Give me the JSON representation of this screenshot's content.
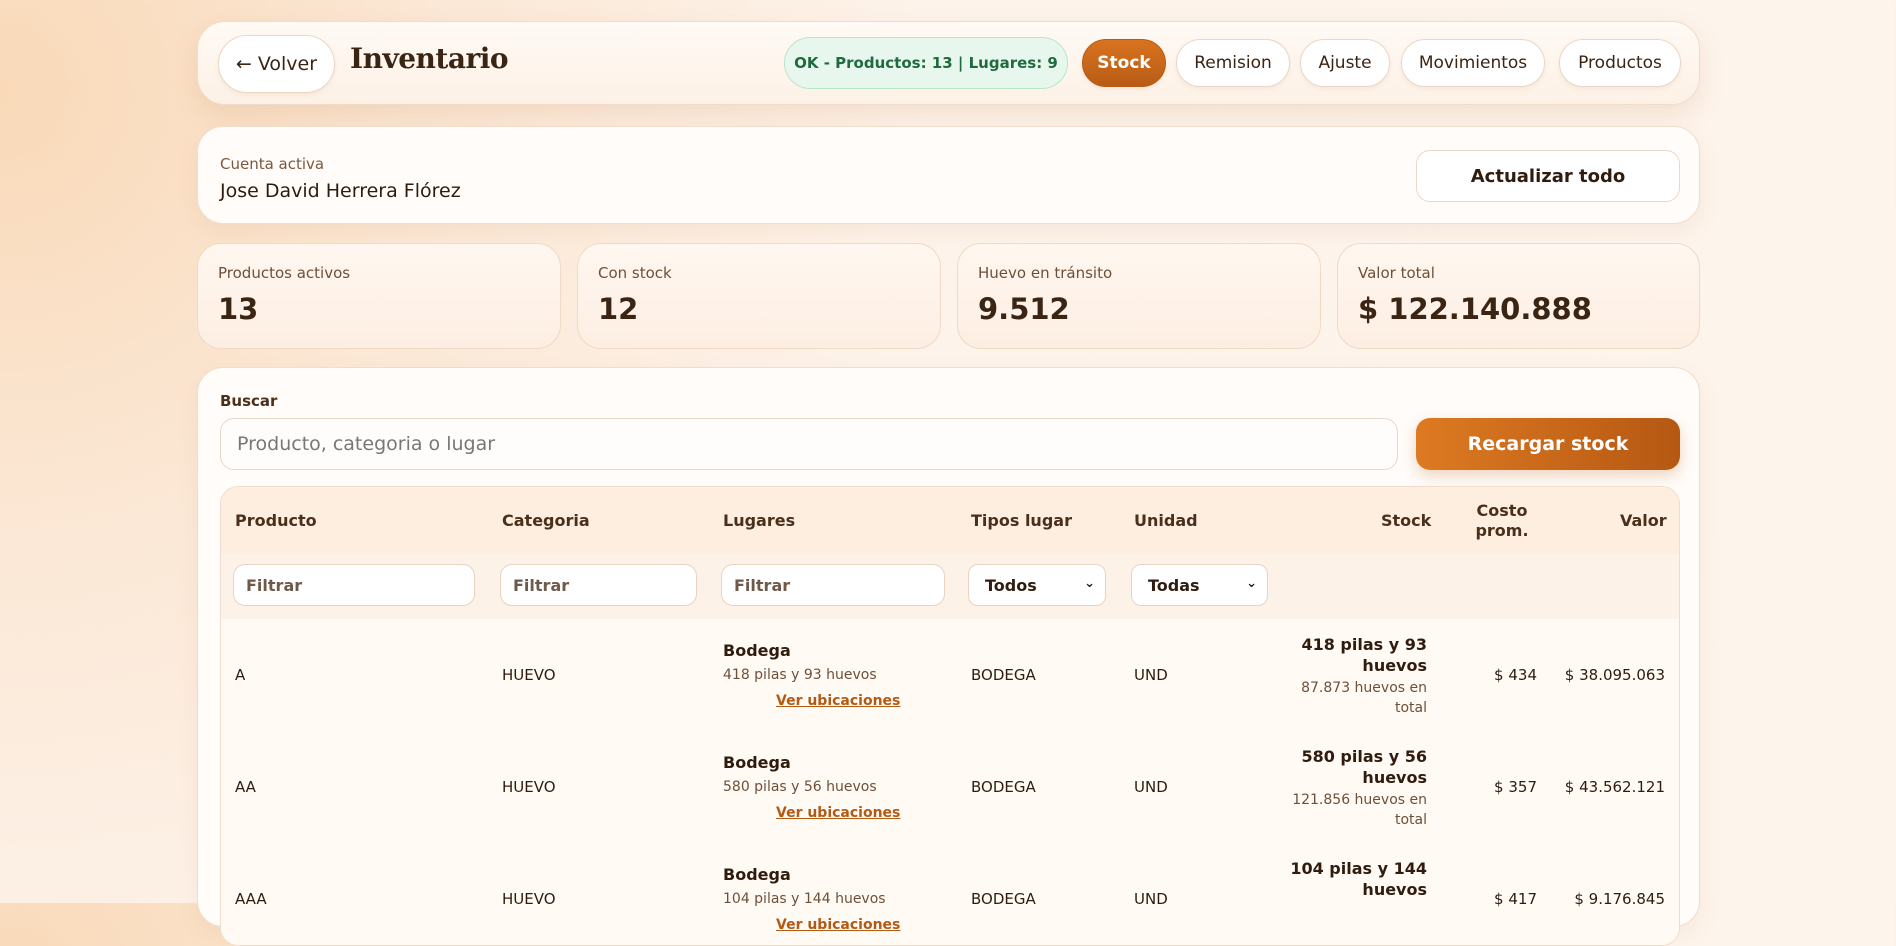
{
  "header": {
    "back_label": "← Volver",
    "title": "Inventario",
    "status": "OK - Productos: 13 | Lugares: 9",
    "tabs": [
      "Stock",
      "Remision",
      "Ajuste",
      "Movimientos",
      "Productos"
    ],
    "active_tab": "Stock"
  },
  "account": {
    "label": "Cuenta activa",
    "name": "Jose David Herrera Flórez",
    "refresh_label": "Actualizar todo"
  },
  "stats": [
    {
      "label": "Productos activos",
      "value": "13"
    },
    {
      "label": "Con stock",
      "value": "12"
    },
    {
      "label": "Huevo en tránsito",
      "value": "9.512"
    },
    {
      "label": "Valor total",
      "value": "$ 122.140.888"
    }
  ],
  "search": {
    "label": "Buscar",
    "placeholder": "Producto, categoria o lugar",
    "reload_label": "Recargar stock"
  },
  "table": {
    "headers": {
      "producto": "Producto",
      "categoria": "Categoria",
      "lugares": "Lugares",
      "tipos_lugar": "Tipos lugar",
      "unidad": "Unidad",
      "stock": "Stock",
      "costo": "Costo prom.",
      "valor": "Valor"
    },
    "filter_placeholder": "Filtrar",
    "tipos_lugar_filter": "Todos",
    "unidad_filter": "Todas",
    "rows": [
      {
        "producto": "A",
        "categoria": "HUEVO",
        "lugar": "Bodega",
        "lugar_detalle": "418 pilas y 93 huevos",
        "link": "Ver ubicaciones",
        "tipo_lugar": "BODEGA",
        "unidad": "UND",
        "stock": "418 pilas y 93 huevos",
        "stock_total": "87.873 huevos en total",
        "costo": "$ 434",
        "valor": "$ 38.095.063"
      },
      {
        "producto": "AA",
        "categoria": "HUEVO",
        "lugar": "Bodega",
        "lugar_detalle": "580 pilas y 56 huevos",
        "link": "Ver ubicaciones",
        "tipo_lugar": "BODEGA",
        "unidad": "UND",
        "stock": "580 pilas y 56 huevos",
        "stock_total": "121.856 huevos en total",
        "costo": "$ 357",
        "valor": "$ 43.562.121"
      },
      {
        "producto": "AAA",
        "categoria": "HUEVO",
        "lugar": "Bodega",
        "lugar_detalle": "104 pilas y 144 huevos",
        "link": "Ver ubicaciones",
        "tipo_lugar": "BODEGA",
        "unidad": "UND",
        "stock": "104 pilas y 144 huevos",
        "stock_total": "",
        "costo": "$ 417",
        "valor": "$ 9.176.845"
      }
    ]
  }
}
